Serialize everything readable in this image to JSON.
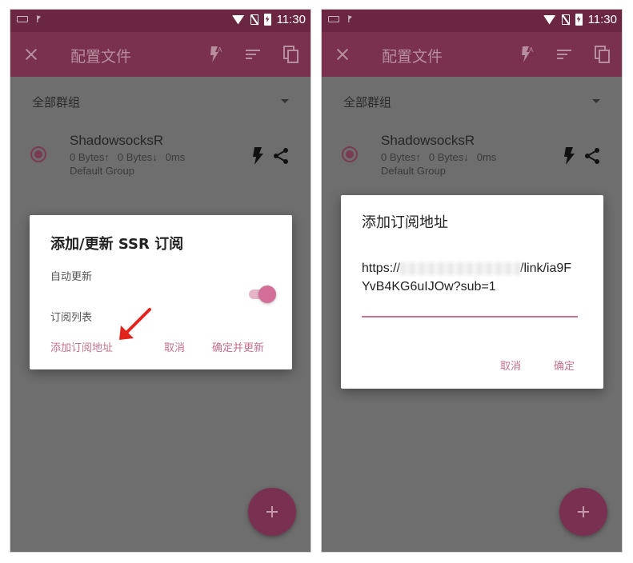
{
  "left_screen": {
    "status": {
      "time": "11:30"
    },
    "toolbar": {
      "title": "配置文件"
    },
    "group_selector": {
      "label": "全部群组"
    },
    "profile": {
      "name": "ShadowsocksR",
      "upload": "0 Bytes↑",
      "download": "0 Bytes↓",
      "latency": "0ms",
      "group": "Default Group"
    },
    "dialog": {
      "title": "添加/更新 SSR 订阅",
      "auto_update_label": "自动更新",
      "auto_update_on": true,
      "sub_list_label": "订阅列表",
      "add_url_button": "添加订阅地址",
      "cancel_button": "取消",
      "confirm_update_button": "确定并更新"
    }
  },
  "right_screen": {
    "status": {
      "time": "11:30"
    },
    "toolbar": {
      "title": "配置文件"
    },
    "group_selector": {
      "label": "全部群组"
    },
    "profile": {
      "name": "ShadowsocksR",
      "upload": "0 Bytes↑",
      "download": "0 Bytes↓",
      "latency": "0ms",
      "group": "Default Group"
    },
    "dialog": {
      "title": "添加订阅地址",
      "url_prefix": "https://",
      "url_rest": "/link/ia9FYvB4KG6uIJOw?sub=1",
      "cancel_button": "取消",
      "confirm_button": "确定"
    }
  },
  "colors": {
    "statusbar": "#6b2742",
    "toolbar": "#79314d",
    "accent": "#c4708f",
    "fab": "#7a3050",
    "annotation_arrow": "#e0241b"
  }
}
